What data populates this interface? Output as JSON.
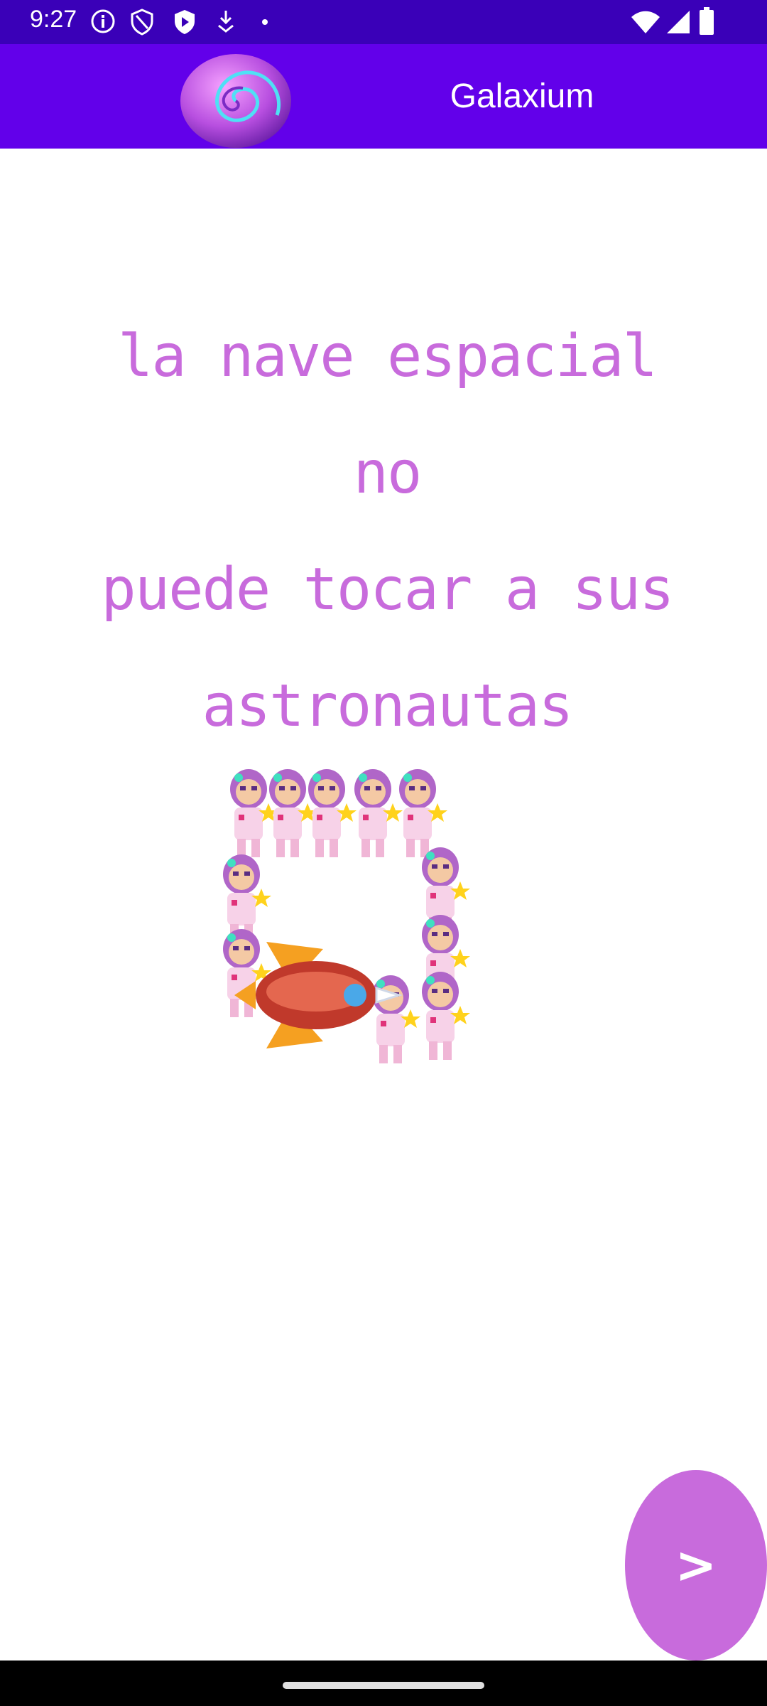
{
  "status_bar": {
    "time": "9:27",
    "icons_left": [
      "info-icon",
      "shield-icon",
      "play-shield-icon",
      "download-icon",
      "dot-icon"
    ],
    "icons_right": [
      "wifi-icon",
      "signal-icon",
      "battery-icon"
    ]
  },
  "app_bar": {
    "title": "Galaxium",
    "logo_icon": "galaxy-planet-logo",
    "color": "#6200ea"
  },
  "content": {
    "instruction_lines": [
      "la nave espacial no",
      "puede tocar a sus",
      "astronautas"
    ],
    "text_color": "#c86bdc",
    "illustration": "astronauts-surrounding-spaceship"
  },
  "next_button": {
    "label": ">",
    "color": "#c86bdc"
  }
}
